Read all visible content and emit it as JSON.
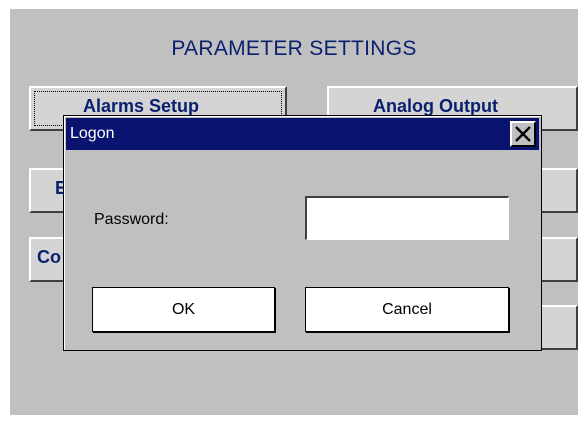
{
  "screen": {
    "title": "PARAMETER SETTINGS",
    "buttons": {
      "alarms_setup": "Alarms Setup",
      "analog_output": "Analog Output",
      "b_partial": "E",
      "co_partial": "Co"
    }
  },
  "dialog": {
    "title": "Logon",
    "close_icon": "close-x-icon",
    "password_label": "Password:",
    "password_value": "",
    "ok_label": "OK",
    "cancel_label": "Cancel"
  },
  "colors": {
    "title_bar": "#0a1470",
    "screen_bg": "#c0c0c0",
    "heading_text": "#0a1f6e"
  }
}
